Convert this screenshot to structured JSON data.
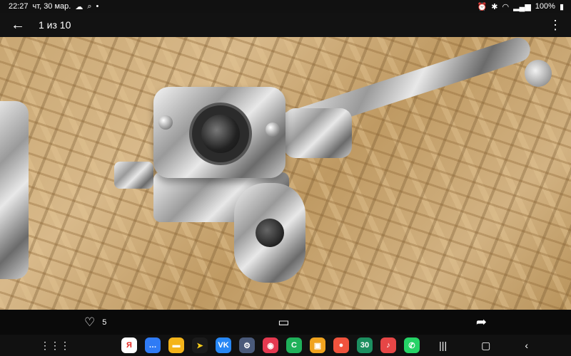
{
  "status": {
    "time": "22:27",
    "date": "чт, 30 мар.",
    "battery": "100%"
  },
  "header": {
    "title": "1 из 10"
  },
  "photo": {
    "subject": "chrome-motorcycle-master-cylinder"
  },
  "actions": {
    "likes": "5"
  },
  "dock": {
    "apps": [
      {
        "icon": "yandex-icon",
        "glyph": "Я",
        "color": "#ffffff",
        "text": "#e52620"
      },
      {
        "icon": "messages-icon",
        "glyph": "…",
        "color": "#2f7bf5",
        "text": "#ffffff"
      },
      {
        "icon": "files-icon",
        "glyph": "▬",
        "color": "#f4b41a",
        "text": "#ffffff"
      },
      {
        "icon": "navigator-icon",
        "glyph": "➤",
        "color": "#1b1b1b",
        "text": "#ffd11a"
      },
      {
        "icon": "vk-icon",
        "glyph": "VK",
        "color": "#2787f5",
        "text": "#ffffff"
      },
      {
        "icon": "settings-icon",
        "glyph": "⚙",
        "color": "#4a5a7a",
        "text": "#ffffff"
      },
      {
        "icon": "screen-recorder-icon",
        "glyph": "◉",
        "color": "#e53950",
        "text": "#ffffff"
      },
      {
        "icon": "phone-icon",
        "glyph": "C",
        "color": "#1fb15a",
        "text": "#ffffff"
      },
      {
        "icon": "store-icon",
        "glyph": "▣",
        "color": "#f0a31e",
        "text": "#ffffff"
      },
      {
        "icon": "contacts-icon",
        "glyph": "●",
        "color": "#f0533d",
        "text": "#ffffff"
      },
      {
        "icon": "calendar-icon",
        "glyph": "30",
        "color": "#1c8f60",
        "text": "#ffffff"
      },
      {
        "icon": "music-icon",
        "glyph": "♪",
        "color": "#e64646",
        "text": "#ffffff"
      },
      {
        "icon": "whatsapp-icon",
        "glyph": "✆",
        "color": "#25d366",
        "text": "#ffffff"
      }
    ]
  }
}
